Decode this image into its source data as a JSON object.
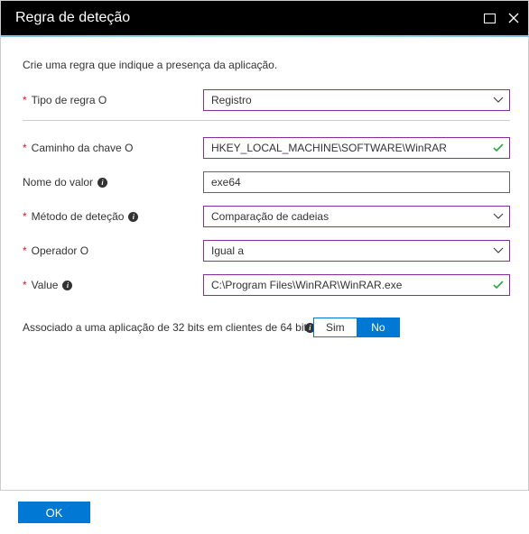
{
  "title": "Regra de deteção",
  "intro": "Crie uma regra que indique a presença da aplicação.",
  "fields": {
    "tipo": {
      "label": "Tipo de regra O",
      "value": "Registro"
    },
    "caminho": {
      "label": "Caminho da chave O",
      "value": "HKEY_LOCAL_MACHINE\\SOFTWARE\\WinRAR"
    },
    "nome": {
      "label": "Nome do valor",
      "value": "exe64"
    },
    "metodo": {
      "label": "Método de deteção",
      "value": "Comparação de cadeias"
    },
    "operador": {
      "label": "Operador O",
      "value": "Igual a"
    },
    "value": {
      "label": "Value",
      "value": "C:\\Program Files\\WinRAR\\WinRAR.exe"
    }
  },
  "toggle": {
    "label": "Associado a uma aplicação de 32 bits em clientes de 64 bits",
    "yes": "Sim",
    "no": "No"
  },
  "ok": "OK",
  "info_glyph": "i"
}
